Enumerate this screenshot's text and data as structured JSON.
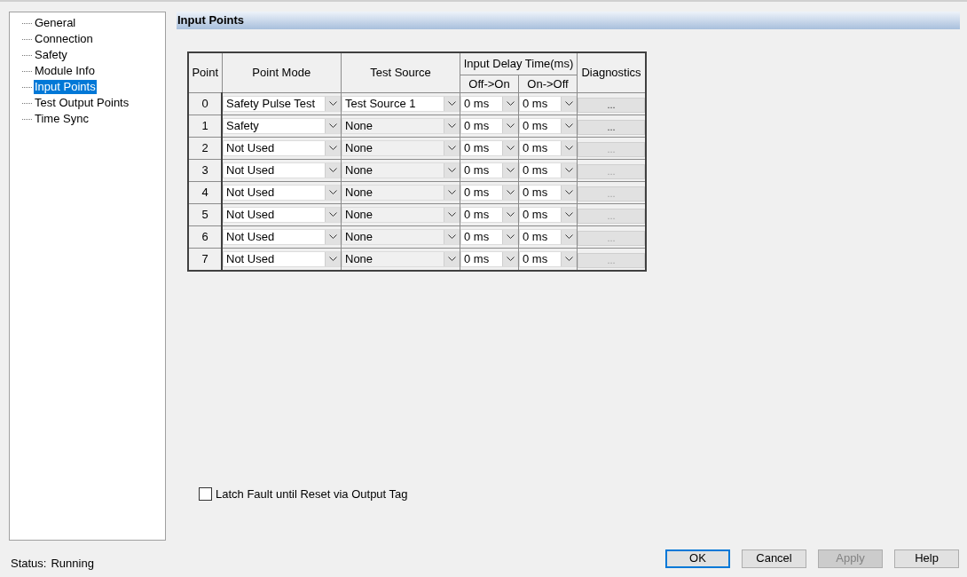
{
  "tree": {
    "items": [
      {
        "label": "General",
        "selected": false
      },
      {
        "label": "Connection",
        "selected": false
      },
      {
        "label": "Safety",
        "selected": false
      },
      {
        "label": "Module Info",
        "selected": false
      },
      {
        "label": "Input Points",
        "selected": true
      },
      {
        "label": "Test Output Points",
        "selected": false
      },
      {
        "label": "Time Sync",
        "selected": false
      }
    ]
  },
  "section_title": "Input Points",
  "table": {
    "columns": {
      "point": "Point",
      "point_mode": "Point Mode",
      "test_source": "Test Source",
      "input_delay": "Input Delay Time(ms)",
      "off_on": "Off->On",
      "on_off": "On->Off",
      "diagnostics": "Diagnostics"
    },
    "rows": [
      {
        "point": "0",
        "point_mode": "Safety Pulse Test",
        "test_source": "Test Source 1",
        "test_source_disabled": false,
        "off_on": "0 ms",
        "on_off": "0 ms",
        "diagnostics": "...",
        "diagnostics_disabled": false
      },
      {
        "point": "1",
        "point_mode": "Safety",
        "test_source": "None",
        "test_source_disabled": true,
        "off_on": "0 ms",
        "on_off": "0 ms",
        "diagnostics": "...",
        "diagnostics_disabled": false
      },
      {
        "point": "2",
        "point_mode": "Not Used",
        "test_source": "None",
        "test_source_disabled": true,
        "off_on": "0 ms",
        "on_off": "0 ms",
        "diagnostics": "...",
        "diagnostics_disabled": true
      },
      {
        "point": "3",
        "point_mode": "Not Used",
        "test_source": "None",
        "test_source_disabled": true,
        "off_on": "0 ms",
        "on_off": "0 ms",
        "diagnostics": "...",
        "diagnostics_disabled": true
      },
      {
        "point": "4",
        "point_mode": "Not Used",
        "test_source": "None",
        "test_source_disabled": true,
        "off_on": "0 ms",
        "on_off": "0 ms",
        "diagnostics": "...",
        "diagnostics_disabled": true
      },
      {
        "point": "5",
        "point_mode": "Not Used",
        "test_source": "None",
        "test_source_disabled": true,
        "off_on": "0 ms",
        "on_off": "0 ms",
        "diagnostics": "...",
        "diagnostics_disabled": true
      },
      {
        "point": "6",
        "point_mode": "Not Used",
        "test_source": "None",
        "test_source_disabled": true,
        "off_on": "0 ms",
        "on_off": "0 ms",
        "diagnostics": "...",
        "diagnostics_disabled": true
      },
      {
        "point": "7",
        "point_mode": "Not Used",
        "test_source": "None",
        "test_source_disabled": true,
        "off_on": "0 ms",
        "on_off": "0 ms",
        "diagnostics": "...",
        "diagnostics_disabled": true
      }
    ]
  },
  "latch_checkbox": {
    "label": "Latch Fault until Reset via Output Tag",
    "checked": false
  },
  "status": {
    "label": "Status:",
    "value": "Running"
  },
  "buttons": [
    {
      "label": "OK",
      "default": true,
      "disabled": false
    },
    {
      "label": "Cancel",
      "default": false,
      "disabled": false
    },
    {
      "label": "Apply",
      "default": false,
      "disabled": true
    },
    {
      "label": "Help",
      "default": false,
      "disabled": false
    }
  ]
}
